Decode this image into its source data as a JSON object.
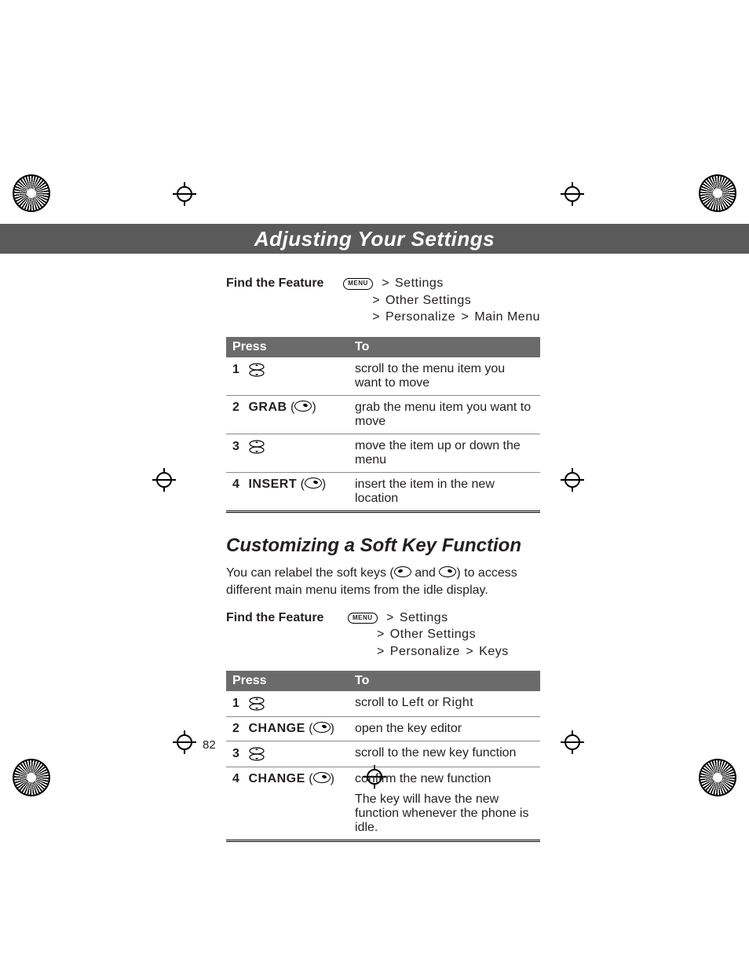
{
  "banner": {
    "title": "Adjusting Your Settings"
  },
  "menu_chip": "MENU",
  "gt": ">",
  "feature1": {
    "label": "Find the Feature",
    "line1_item": "Settings",
    "line2_item": "Other Settings",
    "line3_a": "Personalize",
    "line3_b": "Main Menu"
  },
  "table1": {
    "head_press": "Press",
    "head_to": "To",
    "rows": [
      {
        "num": "1",
        "press": "",
        "to": "scroll to the menu item you want to move"
      },
      {
        "num": "2",
        "press": "GRAB",
        "to": "grab the menu item you want to move"
      },
      {
        "num": "3",
        "press": "",
        "to": "move the item up or down the menu"
      },
      {
        "num": "4",
        "press": "INSERT",
        "to": "insert the item in the new location"
      }
    ]
  },
  "section2": {
    "heading": "Customizing a Soft Key Function",
    "body_a": "You can relabel the soft keys (",
    "body_b": " and ",
    "body_c": ") to access different main menu items from the idle display."
  },
  "feature2": {
    "label": "Find the Feature",
    "line1_item": "Settings",
    "line2_item": "Other Settings",
    "line3_a": "Personalize",
    "line3_b": "Keys"
  },
  "table2": {
    "head_press": "Press",
    "head_to": "To",
    "rows": [
      {
        "num": "1",
        "press": "",
        "to_a": "scroll to ",
        "to_left": "Left",
        "to_or": " or ",
        "to_right": "Right"
      },
      {
        "num": "2",
        "press": "CHANGE",
        "to": "open the key editor"
      },
      {
        "num": "3",
        "press": "",
        "to": "scroll to the new key function"
      },
      {
        "num": "4",
        "press": "CHANGE",
        "to": "confirm the new function",
        "extra": "The key will have the new function whenever the phone is idle."
      }
    ]
  },
  "page_number": "82"
}
